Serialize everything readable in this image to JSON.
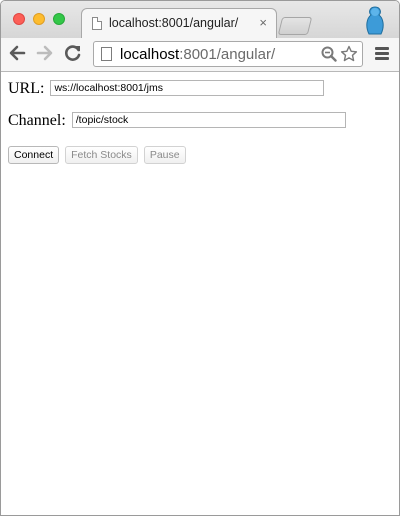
{
  "browser": {
    "tab_title": "localhost:8001/angular/",
    "tab_close": "×",
    "address_host": "localhost",
    "address_rest": ":8001/angular/"
  },
  "icons": {
    "back": "back-arrow-icon",
    "forward": "forward-arrow-icon",
    "reload": "reload-icon",
    "zoom": "zoom-icon",
    "bookmark": "star-icon",
    "menu": "hamburger-menu-icon",
    "profile": "profile-icon"
  },
  "colors": {
    "close": "#fc5f57",
    "minimize": "#fdbc2e",
    "maximize": "#33c748",
    "profile": "#3d9bd8"
  },
  "form": {
    "url_label": "URL:",
    "url_value": "ws://localhost:8001/jms",
    "channel_label": "Channel:",
    "channel_value": "/topic/stock"
  },
  "buttons": {
    "connect": "Connect",
    "fetch_stocks": "Fetch Stocks",
    "pause": "Pause"
  }
}
